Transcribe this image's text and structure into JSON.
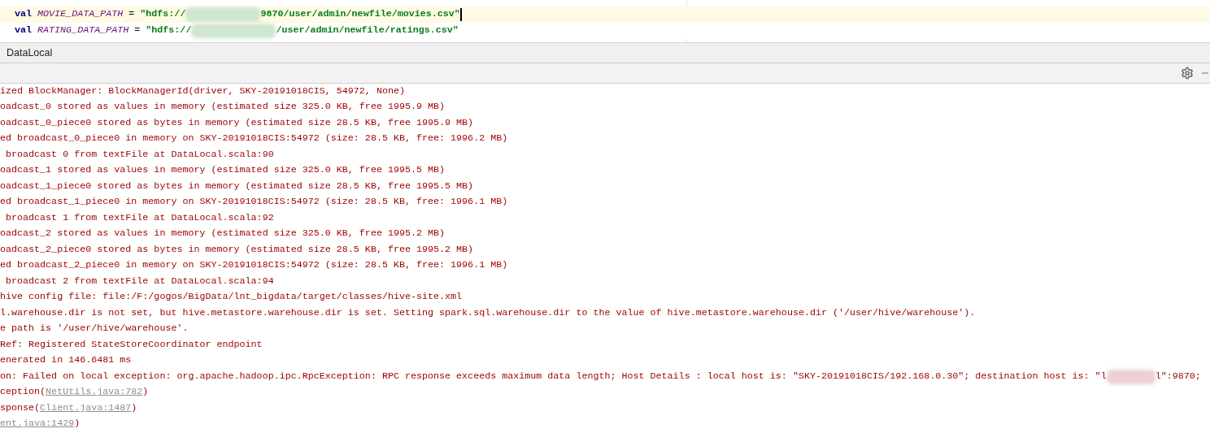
{
  "editor": {
    "lines": [
      {
        "current": true,
        "segments": [
          {
            "kind": "keyword",
            "text": "val"
          },
          {
            "kind": "constant",
            "text": "MOVIE_DATA_PATH"
          },
          {
            "kind": "plain",
            "text": "="
          },
          {
            "kind": "string",
            "text": "\"hdfs://"
          },
          {
            "kind": "redacted"
          },
          {
            "kind": "string",
            "text": "9870/user/admin/newfile/movies.csv\""
          }
        ]
      },
      {
        "current": false,
        "segments": [
          {
            "kind": "keyword",
            "text": "val"
          },
          {
            "kind": "constant",
            "text": "RATING_DATA_PATH"
          },
          {
            "kind": "plain",
            "text": "="
          },
          {
            "kind": "string",
            "text": "\"hdfs://"
          },
          {
            "kind": "redacted"
          },
          {
            "kind": "string",
            "text": "/user/admin/newfile/ratings.csv\""
          }
        ]
      }
    ]
  },
  "console": {
    "tab": "DataLocal",
    "lines": [
      [
        {
          "kind": "text",
          "text": "ized BlockManager: BlockManagerId(driver, SKY-20191018CIS, 54972, None)"
        }
      ],
      [
        {
          "kind": "text",
          "text": "oadcast_0 stored as values in memory (estimated size 325.0 KB, free 1995.9 MB)"
        }
      ],
      [
        {
          "kind": "text",
          "text": "oadcast_0_piece0 stored as bytes in memory (estimated size 28.5 KB, free 1995.9 MB)"
        }
      ],
      [
        {
          "kind": "text",
          "text": "ed broadcast_0_piece0 in memory on SKY-20191018CIS:54972 (size: 28.5 KB, free: 1996.2 MB)"
        }
      ],
      [
        {
          "kind": "text",
          "text": " broadcast 0 from textFile at DataLocal.scala:90"
        }
      ],
      [
        {
          "kind": "text",
          "text": "oadcast_1 stored as values in memory (estimated size 325.0 KB, free 1995.5 MB)"
        }
      ],
      [
        {
          "kind": "text",
          "text": "oadcast_1_piece0 stored as bytes in memory (estimated size 28.5 KB, free 1995.5 MB)"
        }
      ],
      [
        {
          "kind": "text",
          "text": "ed broadcast_1_piece0 in memory on SKY-20191018CIS:54972 (size: 28.5 KB, free: 1996.1 MB)"
        }
      ],
      [
        {
          "kind": "text",
          "text": " broadcast 1 from textFile at DataLocal.scala:92"
        }
      ],
      [
        {
          "kind": "text",
          "text": "oadcast_2 stored as values in memory (estimated size 325.0 KB, free 1995.2 MB)"
        }
      ],
      [
        {
          "kind": "text",
          "text": "oadcast_2_piece0 stored as bytes in memory (estimated size 28.5 KB, free 1995.2 MB)"
        }
      ],
      [
        {
          "kind": "text",
          "text": "ed broadcast_2_piece0 in memory on SKY-20191018CIS:54972 (size: 28.5 KB, free: 1996.1 MB)"
        }
      ],
      [
        {
          "kind": "text",
          "text": " broadcast 2 from textFile at DataLocal.scala:94"
        }
      ],
      [
        {
          "kind": "text",
          "text": "hive config file: file:/F:/gogos/BigData/lnt_bigdata/target/classes/hive-site.xml"
        }
      ],
      [
        {
          "kind": "text",
          "text": "l.warehouse.dir is not set, but hive.metastore.warehouse.dir is set. Setting spark.sql.warehouse.dir to the value of hive.metastore.warehouse.dir ('/user/hive/warehouse')."
        }
      ],
      [
        {
          "kind": "text",
          "text": "e path is '/user/hive/warehouse'."
        }
      ],
      [
        {
          "kind": "text",
          "text": "Ref: Registered StateStoreCoordinator endpoint"
        }
      ],
      [
        {
          "kind": "text",
          "text": "enerated in 146.6481 ms"
        }
      ],
      [
        {
          "kind": "text",
          "text": "on: Failed on local exception: org.apache.hadoop.ipc.RpcException: RPC response exceeds maximum data length; Host Details : local host is: \"SKY-20191018CIS/192.168.0.30\"; destination host is: \"l"
        },
        {
          "kind": "redacted"
        },
        {
          "kind": "text",
          "text": "l\":9870;"
        }
      ],
      [
        {
          "kind": "text",
          "text": "ception("
        },
        {
          "kind": "link",
          "text": "NetUtils.java:782"
        },
        {
          "kind": "text",
          "text": ")"
        }
      ],
      [
        {
          "kind": "text",
          "text": "sponse("
        },
        {
          "kind": "link",
          "text": "Client.java:1487"
        },
        {
          "kind": "text",
          "text": ")"
        }
      ],
      [
        {
          "kind": "link",
          "text": "ent.java:1429"
        },
        {
          "kind": "text",
          "text": ")"
        }
      ]
    ]
  }
}
